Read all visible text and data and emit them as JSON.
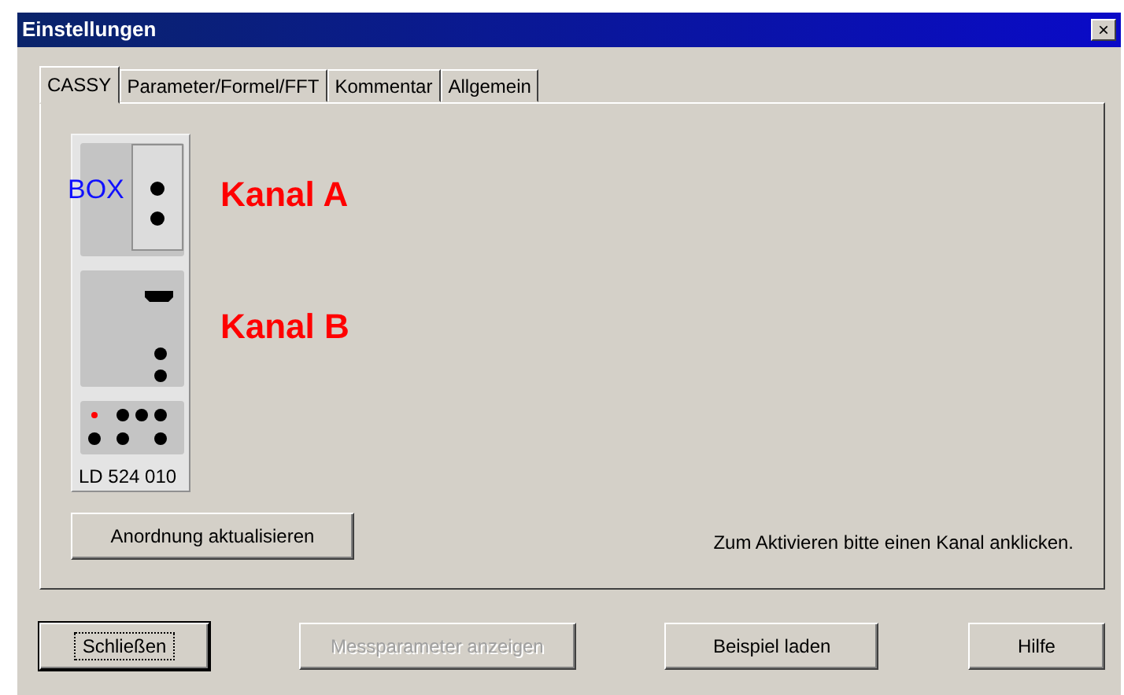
{
  "window": {
    "title": "Einstellungen",
    "close": "×"
  },
  "tabs": [
    {
      "label": "CASSY",
      "selected": true
    },
    {
      "label": "Parameter/Formel/FFT",
      "selected": false
    },
    {
      "label": "Kommentar",
      "selected": false
    },
    {
      "label": "Allgemein",
      "selected": false
    }
  ],
  "device": {
    "box_label": "BOX",
    "model": "LD 524 010"
  },
  "channels": [
    {
      "label": "Kanal A"
    },
    {
      "label": "Kanal B"
    }
  ],
  "update_button": "Anordnung aktualisieren",
  "hint": "Zum Aktivieren bitte einen Kanal anklicken.",
  "buttons": [
    {
      "label": "Schließen",
      "disabled": false,
      "default": true
    },
    {
      "label": "Messparameter anzeigen",
      "disabled": true,
      "default": false
    },
    {
      "label": "Beispiel laden",
      "disabled": false,
      "default": false
    },
    {
      "label": "Hilfe",
      "disabled": false,
      "default": false
    }
  ]
}
